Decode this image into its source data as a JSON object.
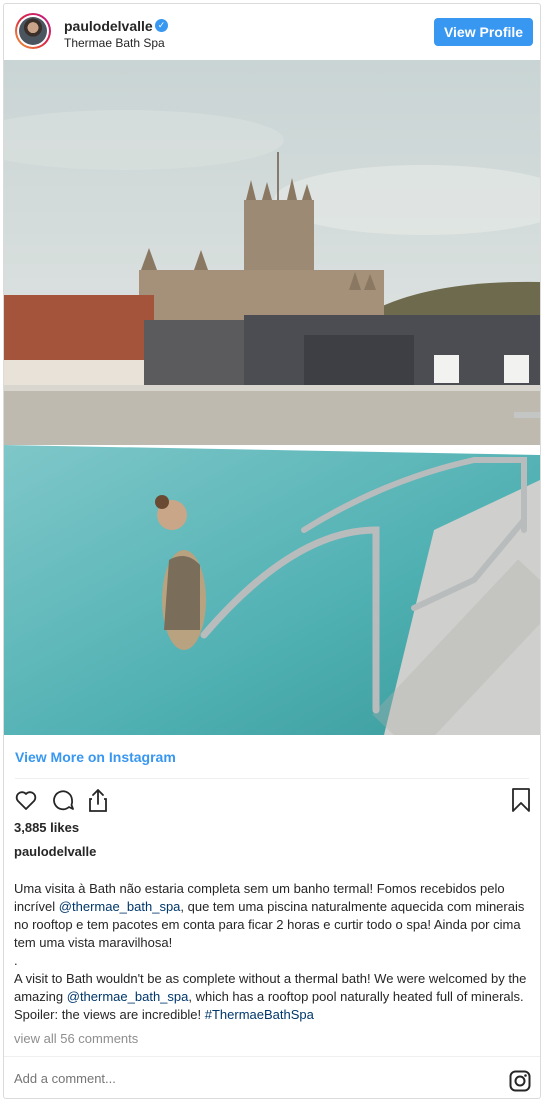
{
  "header": {
    "username": "paulodelvalle",
    "verified_symbol": "✓",
    "location": "Thermae Bath Spa",
    "view_profile_label": "View Profile"
  },
  "post": {
    "image_alt": "Woman in rooftop thermal pool overlooking Bath Abbey",
    "view_more_label": "View More on Instagram",
    "likes": "3,885 likes",
    "caption_username": "paulodelvalle",
    "caption_pt_1": "Uma visita à Bath não estaria completa sem um banho termal! Fomos recebidos pelo incrível ",
    "caption_pt_mention": "@thermae_bath_spa",
    "caption_pt_2": ", que tem uma piscina naturalmente aquecida com minerais no rooftop e tem pacotes em conta para ficar 2 horas e curtir todo o spa! Ainda por cima tem uma vista maravilhosa!",
    "caption_dot": ".",
    "caption_en_1": "A visit to Bath wouldn't be as complete without a thermal bath! We were welcomed by the amazing ",
    "caption_en_mention": "@thermae_bath_spa",
    "caption_en_2": ", which has a rooftop pool naturally heated full of minerals. Spoiler: the views are incredible! ",
    "caption_hashtag": "#ThermaeBathSpa",
    "view_comments": "view all 56 comments",
    "add_comment_placeholder": "Add a comment..."
  },
  "icons": {
    "like": "heart-icon",
    "comment": "comment-icon",
    "share": "share-icon",
    "save": "bookmark-icon",
    "instagram": "instagram-icon"
  },
  "colors": {
    "accent": "#3897f0",
    "text": "#262626",
    "muted": "#8e8e8e",
    "mention": "#00376b"
  }
}
